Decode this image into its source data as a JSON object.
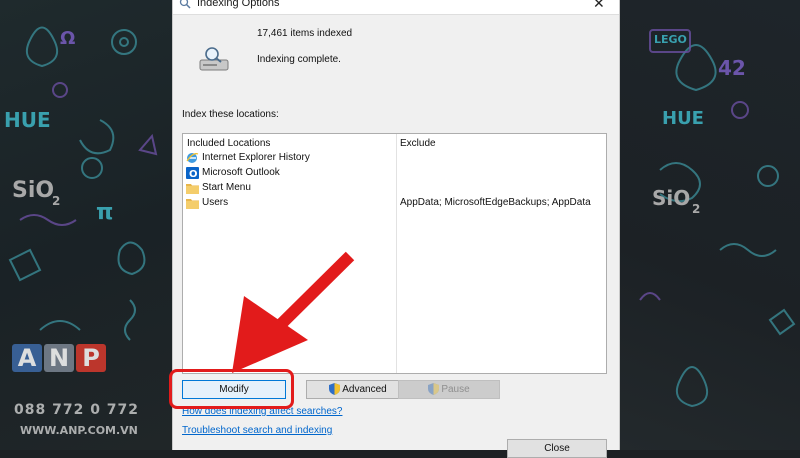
{
  "window": {
    "title": "Indexing Options",
    "close_glyph": "✕"
  },
  "status": {
    "items_indexed": "17,461 items indexed",
    "state": "Indexing complete."
  },
  "locations": {
    "section_label": "Index these locations:",
    "columns": {
      "included": "Included Locations",
      "exclude": "Exclude"
    },
    "rows": [
      {
        "label": "Internet Explorer History",
        "exclude": "",
        "icon": "ie-icon"
      },
      {
        "label": "Microsoft Outlook",
        "exclude": "",
        "icon": "outlook-icon"
      },
      {
        "label": "Start Menu",
        "exclude": "",
        "icon": "folder-icon"
      },
      {
        "label": "Users",
        "exclude": "AppData; MicrosoftEdgeBackups; AppData",
        "icon": "folder-icon"
      }
    ]
  },
  "buttons": {
    "modify": "Modify",
    "advanced": "Advanced",
    "pause": "Pause",
    "close": "Close"
  },
  "links": {
    "how_affects": "How does indexing affect searches?",
    "troubleshoot": "Troubleshoot search and indexing"
  },
  "wallpaper": {
    "labels": [
      "HUE",
      "SiO",
      "2",
      "Ω",
      "π",
      "HUE",
      "SiO",
      "2",
      "42",
      "LEGO"
    ]
  },
  "watermark": {
    "letters": [
      "A",
      "N",
      "P"
    ],
    "phone": "088 772 0 772",
    "website": "WWW.ANP.COM.VN"
  },
  "colors": {
    "accent_red": "#e21b1b",
    "link_blue": "#0066cc",
    "button_focus": "#0078d7"
  }
}
